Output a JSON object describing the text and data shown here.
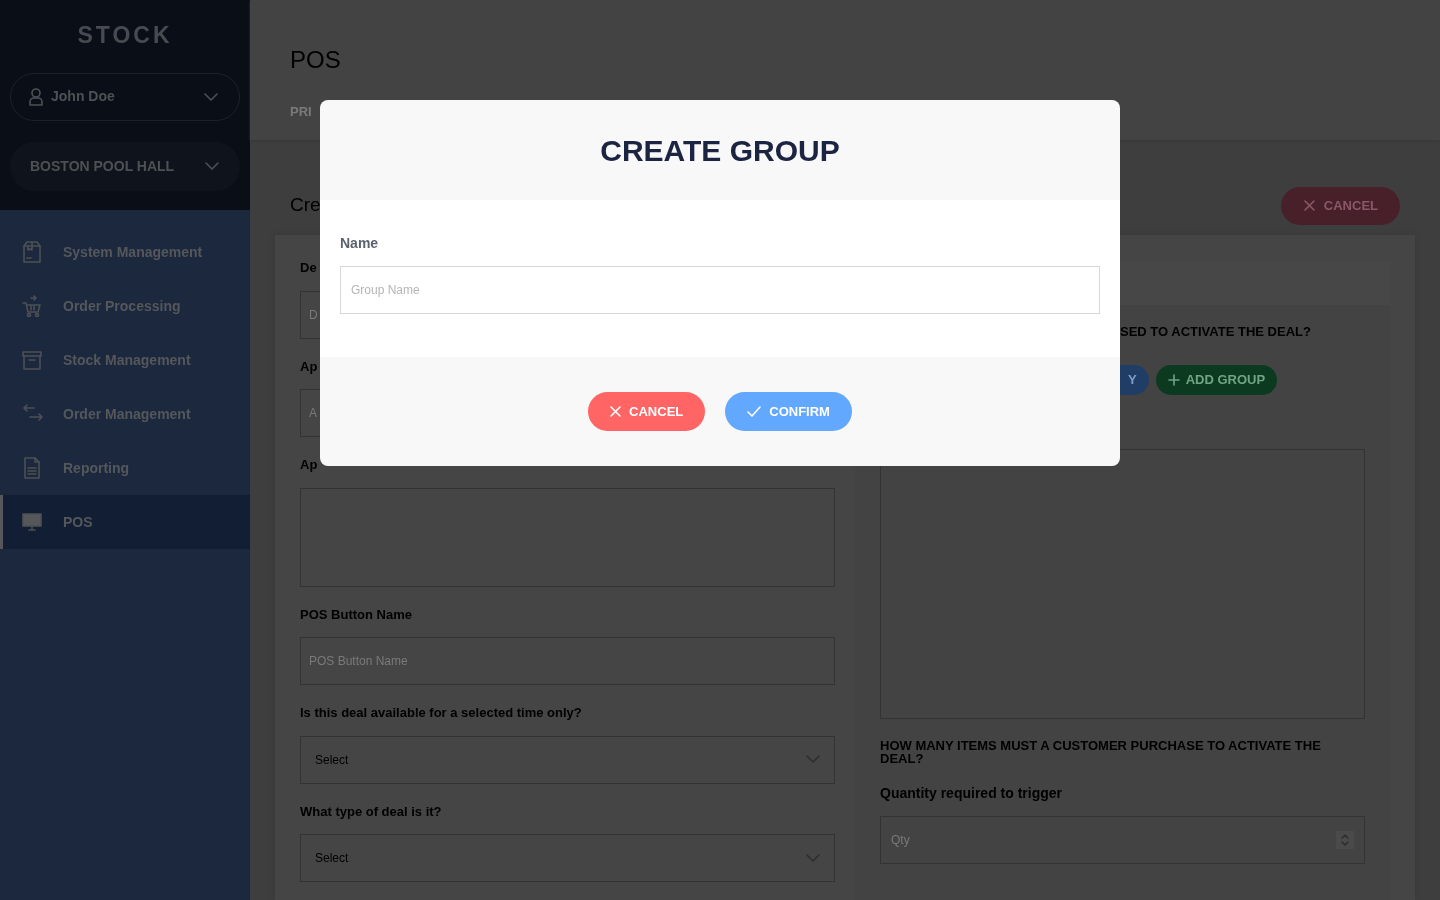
{
  "sidebar": {
    "logo": "STOCK",
    "user": "John Doe",
    "location": "BOSTON POOL HALL",
    "items": [
      {
        "label": "System Management",
        "kind": "package",
        "selected": false
      },
      {
        "label": "Order Processing",
        "kind": "cart",
        "selected": false
      },
      {
        "label": "Stock Management",
        "kind": "archive",
        "selected": false
      },
      {
        "label": "Order Management",
        "kind": "arrows",
        "selected": false
      },
      {
        "label": "Reporting",
        "kind": "document",
        "selected": false
      },
      {
        "label": "POS",
        "kind": "monitor",
        "selected": true
      }
    ]
  },
  "page": {
    "title": "POS",
    "tabs": [
      {
        "label": "PRI"
      }
    ],
    "subtitle": "Cre",
    "cancel_button": "CANCEL"
  },
  "left_form": [
    {
      "label": "De",
      "kind": "input",
      "placeholder": "D"
    },
    {
      "label": "Ap",
      "kind": "input",
      "placeholder": "A"
    },
    {
      "label": "Ap",
      "kind": "textarea"
    },
    {
      "label": "POS Button Name",
      "kind": "input",
      "placeholder": "POS Button Name"
    },
    {
      "label": "Is this deal available for a selected time only?",
      "kind": "select",
      "value": "Select"
    },
    {
      "label": "What type of deal is it?",
      "kind": "select",
      "value": "Select"
    }
  ],
  "right_panel": {
    "question": "SED TO ACTIVATE THE DEAL?",
    "buttons": [
      {
        "label": "Y",
        "kind": "primary"
      },
      {
        "label": "ADD GROUP",
        "kind": "add"
      }
    ],
    "quantity_heading": "HOW MANY ITEMS MUST A CUSTOMER PURCHASE TO ACTIVATE THE DEAL?",
    "quantity_label": "Quantity required to trigger",
    "quantity_placeholder": "Qty"
  },
  "modal": {
    "title": "CREATE GROUP",
    "field_label": "Name",
    "placeholder": "Group Name",
    "buttons": [
      {
        "label": "CANCEL",
        "kind": "cancel"
      },
      {
        "label": "CONFIRM",
        "kind": "confirm"
      }
    ]
  }
}
